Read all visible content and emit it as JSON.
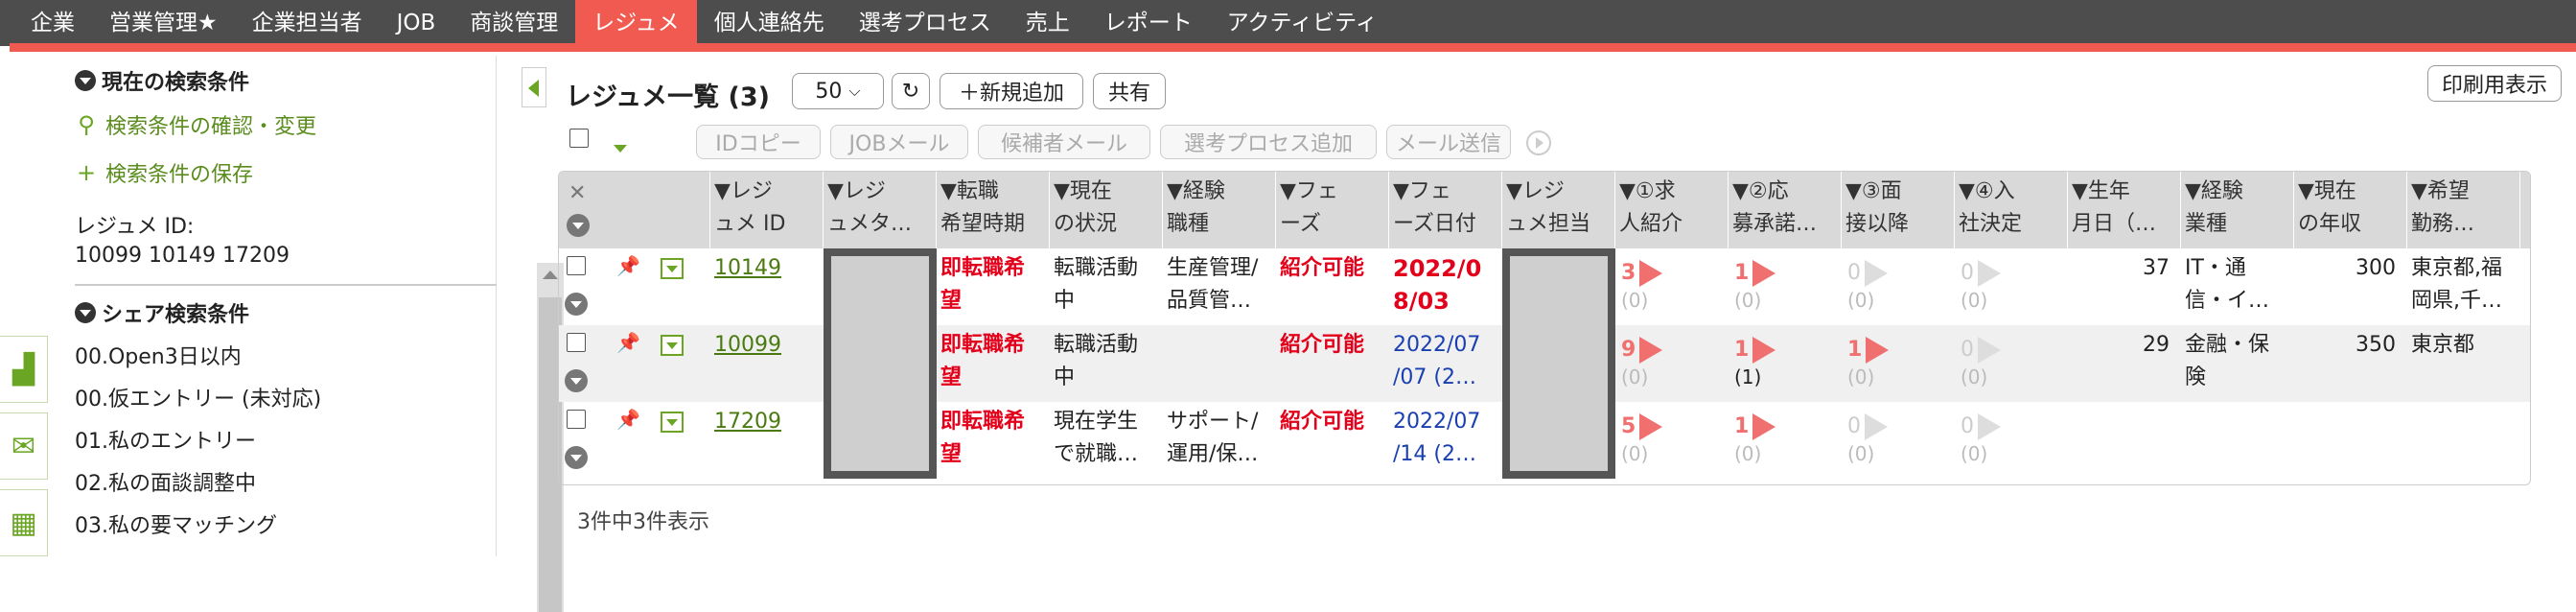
{
  "nav": [
    "企業",
    "営業管理★",
    "企業担当者",
    "JOB",
    "商談管理",
    "レジュメ",
    "個人連絡先",
    "選考プロセス",
    "売上",
    "レポート",
    "アクティビティ"
  ],
  "nav_active": 5,
  "side": {
    "current_title": "現在の検索条件",
    "check_link": "検索条件の確認・変更",
    "save_link": "検索条件の保存",
    "id_label": "レジュメ ID:",
    "id_values": "10099 10149 17209",
    "share_title": "シェア検索条件",
    "shares": [
      "00.Open3日以内",
      "00.仮エントリー (未対応)",
      "01.私のエントリー",
      "02.私の面談調整中",
      "03.私の要マッチング"
    ]
  },
  "main": {
    "title": "レジュメ一覧 (3)",
    "per_page": "50",
    "new_btn": "＋新規追加",
    "share_btn": "共有",
    "print_btn": "印刷用表示",
    "actions": [
      "IDコピー",
      "JOBメール",
      "候補者メール",
      "選考プロセス追加",
      "メール送信"
    ],
    "footer": "3件中3件表示"
  },
  "columns": [
    [
      "▼レジ",
      "ュメ ID"
    ],
    [
      "▼レジ",
      "ュメタ…"
    ],
    [
      "▼転職",
      "希望時期"
    ],
    [
      "▼現在",
      "の状況"
    ],
    [
      "▼経験",
      "職種"
    ],
    [
      "▼フェ",
      "ーズ"
    ],
    [
      "▼フェ",
      "ーズ日付"
    ],
    [
      "▼レジ",
      "ュメ担当"
    ],
    [
      "▼①求",
      "人紹介"
    ],
    [
      "▼②応",
      "募承諾…"
    ],
    [
      "▼③面",
      "接以降"
    ],
    [
      "▼④入",
      "社決定"
    ],
    [
      "▼生年",
      "月日（…"
    ],
    [
      "▼経験",
      "業種"
    ],
    [
      "▼現在",
      "の年収"
    ],
    [
      "▼希望",
      "勤務…"
    ]
  ],
  "rows": [
    {
      "id": "10149",
      "timing": [
        "即転職希",
        "望"
      ],
      "status": [
        "転職活動",
        "中"
      ],
      "job": [
        "生産管理/",
        "品質管…"
      ],
      "phase": "紹介可能",
      "date": [
        "2022/0",
        "8/03"
      ],
      "date_red": true,
      "c1": "3",
      "c1s": "(0)",
      "c2": "1",
      "c2s": "(0)",
      "c3": "0",
      "c3s": "(0)",
      "c4": "0",
      "c4s": "(0)",
      "age": "37",
      "ind": [
        "IT・通",
        "信・イ…"
      ],
      "income": "300",
      "loc": [
        "東京都,福",
        "岡県,千…"
      ]
    },
    {
      "id": "10099",
      "timing": [
        "即転職希",
        "望"
      ],
      "status": [
        "転職活動",
        "中"
      ],
      "job": [
        "",
        ""
      ],
      "phase": "紹介可能",
      "date": [
        "2022/07",
        "/07 (2…"
      ],
      "date_red": false,
      "c1": "9",
      "c1s": "(0)",
      "c2": "1",
      "c2s": "(1)",
      "c3": "1",
      "c3s": "(0)",
      "c4": "0",
      "c4s": "(0)",
      "age": "29",
      "ind": [
        "金融・保",
        "険"
      ],
      "income": "350",
      "loc": [
        "東京都",
        ""
      ]
    },
    {
      "id": "17209",
      "timing": [
        "即転職希",
        "望"
      ],
      "status": [
        "現在学生",
        "で就職…"
      ],
      "job": [
        "サポート/",
        "運用/保…"
      ],
      "phase": "紹介可能",
      "date": [
        "2022/07",
        "/14 (2…"
      ],
      "date_red": false,
      "c1": "5",
      "c1s": "(0)",
      "c2": "1",
      "c2s": "(0)",
      "c3": "0",
      "c3s": "(0)",
      "c4": "0",
      "c4s": "(0)",
      "age": "",
      "ind": [
        "",
        ""
      ],
      "income": "",
      "loc": [
        "",
        ""
      ]
    }
  ]
}
